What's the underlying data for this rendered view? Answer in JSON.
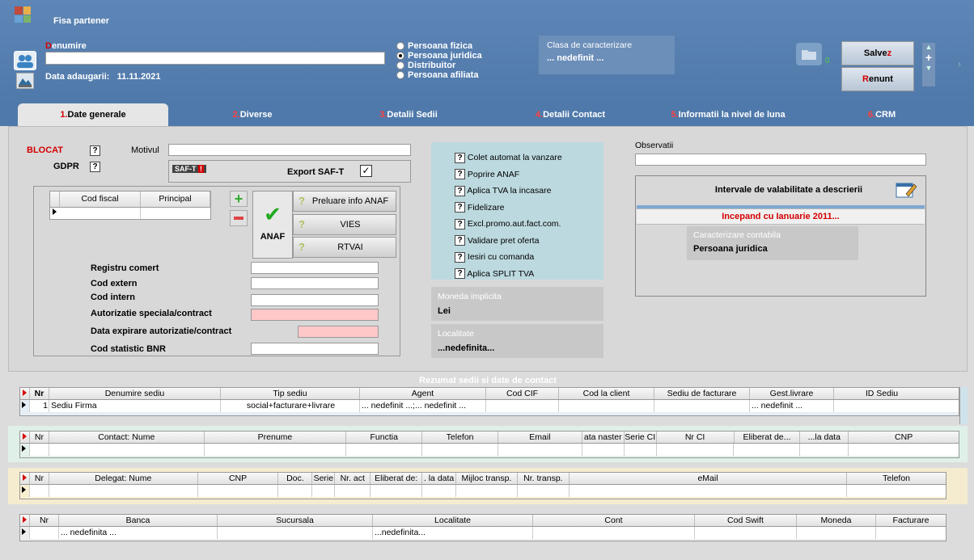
{
  "header": {
    "title": "Fisa partener",
    "denumire_first": "D",
    "denumire_rest": "enumire",
    "denumire_value": "",
    "data_adaugarii_label": "Data adaugarii:",
    "data_adaugarii_value": "11.11.2021",
    "radios": [
      "Persoana fizica",
      "Persoana juridica",
      "Distribuitor",
      "Persoana afiliata"
    ],
    "clasa_label": "Clasa de caracterizare",
    "clasa_value": "... nedefinit ...",
    "folder_count": "0",
    "save_main": "Salve",
    "save_hot": "z",
    "cancel_hot": "R",
    "cancel_main": "enunt"
  },
  "tabs": [
    {
      "num": "1.",
      "label": "Date generale"
    },
    {
      "num": "2.",
      "label": "Diverse"
    },
    {
      "num": "3.",
      "label": "Detalii Sedii"
    },
    {
      "num": "4.",
      "label": "Detalii Contact"
    },
    {
      "num": "5.",
      "label": "Informatii la nivel de luna"
    },
    {
      "num": "6.",
      "label": "CRM"
    }
  ],
  "general": {
    "blocat": "BLOCAT",
    "gdpr": "GDPR",
    "motivul": "Motivul",
    "saft_badge": "SAF-T",
    "export_saft": "Export SAF-T",
    "cod_fiscal": "Cod fiscal",
    "principal": "Principal",
    "preluare": "Preluare info ANAF",
    "vies": "VIES",
    "rtvai": "RTVAI",
    "anaf": "ANAF",
    "fields": [
      "Registru comert",
      "Cod extern",
      "Cod intern",
      "Autorizatie speciala/contract",
      "Data expirare autorizatie/contract",
      "Cod statistic BNR"
    ],
    "options": [
      "Colet automat la vanzare",
      "Poprire ANAF",
      "Aplica TVA la incasare",
      "Fidelizare",
      "Excl.promo.aut.fact.com.",
      "Validare pret oferta",
      "Iesiri cu comanda",
      "Aplica SPLIT TVA"
    ],
    "moneda_label": "Moneda implicita",
    "moneda_value": "Lei",
    "localitate_label": "Localitate",
    "localitate_value": "...nedefinita...",
    "observatii": "Observatii",
    "intervale_title": "Intervale de valabilitate a descrierii",
    "incepand": "Incepand cu Ianuarie 2011...",
    "caract_label": "Caracterizare contabila",
    "caract_value": "Persoana juridica"
  },
  "summary_title": "Rezumat sedii si date de contact",
  "sedii": {
    "cols": [
      "Nr",
      "Denumire sediu",
      "Tip sediu",
      "Agent",
      "Cod CIF",
      "Cod la client",
      "Sediu de facturare",
      "Gest.livrare",
      "ID Sediu"
    ],
    "row": [
      "1",
      "Sediu Firma",
      "social+facturare+livrare",
      "... nedefinit ...;... nedefinit ...",
      "",
      "",
      "",
      "... nedefinit ...",
      ""
    ]
  },
  "contact": {
    "cols": [
      "Nr",
      "Contact: Nume",
      "Prenume",
      "Functia",
      "Telefon",
      "Email",
      "ata naster",
      "Serie CI",
      "Nr CI",
      "Eliberat de...",
      "...la data",
      "CNP"
    ]
  },
  "delegat": {
    "cols": [
      "Nr",
      "Delegat: Nume",
      "CNP",
      "Doc.",
      "Serie",
      "Nr. act",
      "Eliberat de:",
      ". la data",
      "Mijloc transp.",
      "Nr. transp.",
      "eMail",
      "Telefon"
    ]
  },
  "banca": {
    "cols": [
      "Nr",
      "Banca",
      "Sucursala",
      "Localitate",
      "Cont",
      "Cod Swift",
      "Moneda",
      "Facturare"
    ],
    "row": [
      "",
      "... nedefinita ...",
      "",
      "...nedefinita...",
      "",
      "",
      "",
      ""
    ]
  },
  "colors": {
    "header": "#5e86b6",
    "accent_red": "#d40000",
    "blue_panel": "#bcd9df",
    "cream": "#f5ecd0",
    "green": "#dff0e8"
  }
}
